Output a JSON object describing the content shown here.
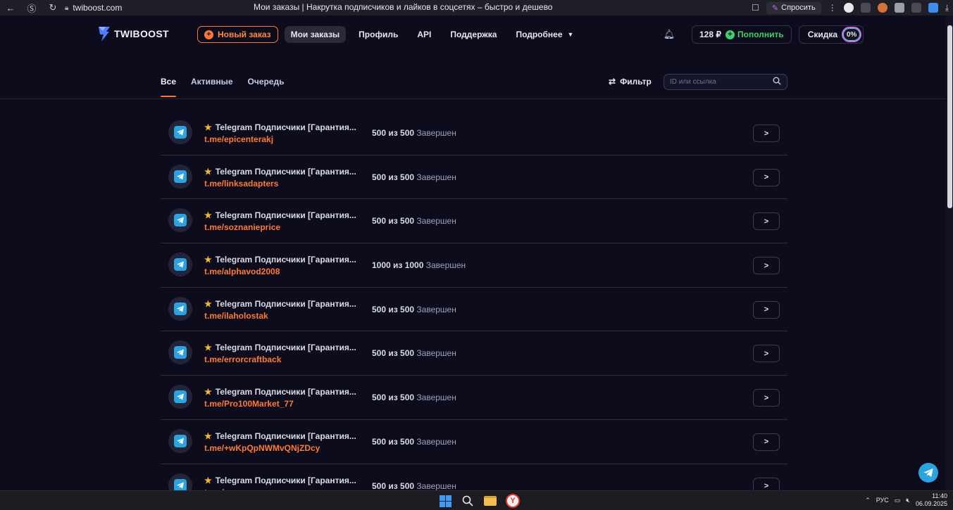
{
  "browser": {
    "url": "twiboost.com",
    "tab_title": "Мои заказы | Накрутка подписчиков и лайков в соцсетях – быстро и дешево",
    "ask_label": "Спросить"
  },
  "header": {
    "logo_text": "TWIBOOST",
    "new_order_label": "Новый заказ",
    "nav": [
      {
        "label": "Мои заказы",
        "active": true
      },
      {
        "label": "Профиль"
      },
      {
        "label": "API"
      },
      {
        "label": "Поддержка"
      },
      {
        "label": "Подробнее"
      }
    ],
    "balance": "128 ₽",
    "topup_label": "Пополнить",
    "discount_label": "Скидка",
    "discount_value": "0%"
  },
  "tabs": [
    {
      "label": "Все",
      "active": true
    },
    {
      "label": "Активные"
    },
    {
      "label": "Очередь"
    }
  ],
  "filter_label": "Фильтр",
  "search": {
    "placeholder": "ID или ссылка",
    "value": ""
  },
  "orders": [
    {
      "title": "Telegram Подписчики [Гарантия...",
      "link": "t.me/epicenterakj",
      "count": "500 из 500",
      "status": "Завершен"
    },
    {
      "title": "Telegram Подписчики [Гарантия...",
      "link": "t.me/linksadapters",
      "count": "500 из 500",
      "status": "Завершен"
    },
    {
      "title": "Telegram Подписчики [Гарантия...",
      "link": "t.me/soznanieprice",
      "count": "500 из 500",
      "status": "Завершен"
    },
    {
      "title": "Telegram Подписчики [Гарантия...",
      "link": "t.me/alphavod2008",
      "count": "1000 из 1000",
      "status": "Завершен"
    },
    {
      "title": "Telegram Подписчики [Гарантия...",
      "link": "t.me/ilaholostak",
      "count": "500 из 500",
      "status": "Завершен"
    },
    {
      "title": "Telegram Подписчики [Гарантия...",
      "link": "t.me/errorcraftback",
      "count": "500 из 500",
      "status": "Завершен"
    },
    {
      "title": "Telegram Подписчики [Гарантия...",
      "link": "t.me/Pro100Market_77",
      "count": "500 из 500",
      "status": "Завершен"
    },
    {
      "title": "Telegram Подписчики [Гарантия...",
      "link": "t.me/+wKpQpNWMvQNjZDcy",
      "count": "500 из 500",
      "status": "Завершен"
    },
    {
      "title": "Telegram Подписчики [Гарантия...",
      "link": "t.me/...",
      "count": "500 из 500",
      "status": "Завершен"
    }
  ],
  "taskbar": {
    "lang": "РУС",
    "time": "11:40",
    "date": "06.09.2025"
  },
  "colors": {
    "accent": "#ff7a2f",
    "topup": "#3fd26a",
    "telegram": "#2aa3e0",
    "background": "#0d0c1d"
  }
}
